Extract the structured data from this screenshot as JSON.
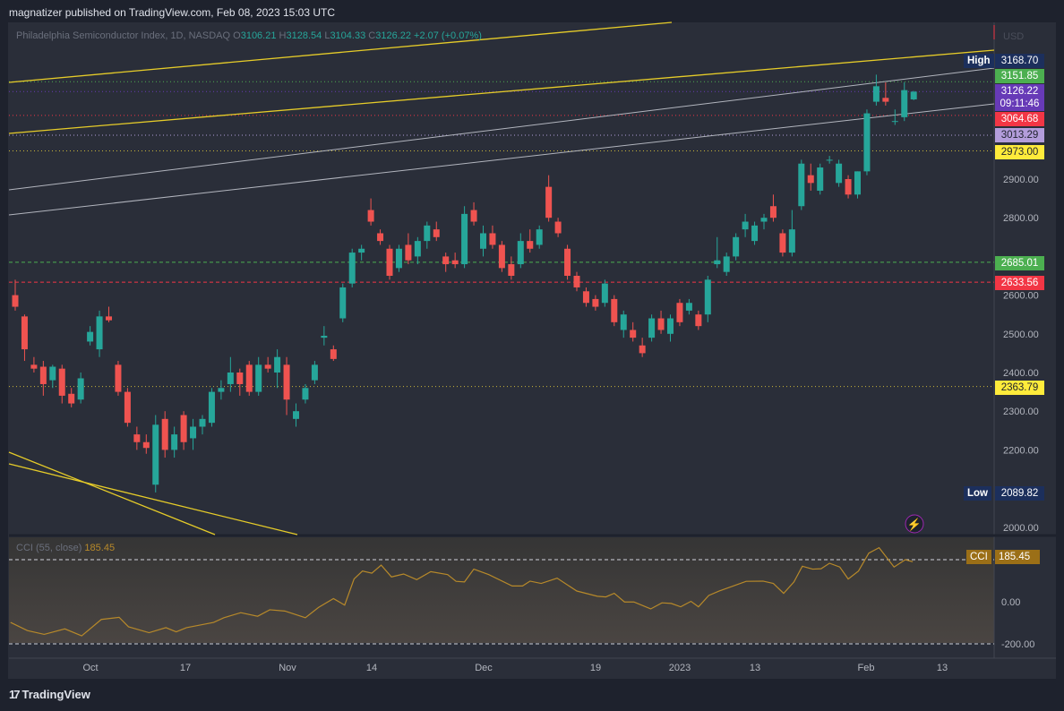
{
  "header": {
    "published": "magnatizer published on TradingView.com, Feb 08, 2023 15:03 UTC"
  },
  "legend": {
    "symbol": "Philadelphia Semiconductor Index, 1D, NASDAQ",
    "o_label": "O",
    "o": "3106.21",
    "h_label": "H",
    "h": "3128.54",
    "l_label": "L",
    "l": "3104.33",
    "c_label": "C",
    "c": "3126.22",
    "change": "+2.07 (+0.07%)"
  },
  "currency": "USD",
  "price_axis": {
    "ticks": [
      2000,
      2200,
      2300,
      2400,
      2500,
      2600,
      2800,
      2900
    ]
  },
  "price_labels": [
    {
      "tag": "High",
      "value": "3168.70",
      "bg": "#1c2f5c",
      "fg": "#ffffff"
    },
    {
      "value": "3151.85",
      "bg": "#4caf50",
      "fg": "#ffffff"
    },
    {
      "value": "3126.22",
      "sub": "09:11:46",
      "bg": "#673ab7",
      "fg": "#ffffff"
    },
    {
      "value": "3064.68",
      "bg": "#f23645",
      "fg": "#ffffff"
    },
    {
      "value": "3013.29",
      "bg": "#b39ddb",
      "fg": "#1e222d"
    },
    {
      "value": "2973.00",
      "bg": "#ffeb3b",
      "fg": "#1e222d"
    },
    {
      "value": "2685.01",
      "bg": "#4caf50",
      "fg": "#ffffff"
    },
    {
      "value": "2633.56",
      "bg": "#f23645",
      "fg": "#ffffff"
    },
    {
      "value": "2363.79",
      "bg": "#ffeb3b",
      "fg": "#1e222d"
    },
    {
      "tag": "Low",
      "value": "2089.82",
      "bg": "#1c2f5c",
      "fg": "#ffffff"
    }
  ],
  "time_axis": [
    "Oct",
    "17",
    "Nov",
    "14",
    "Dec",
    "19",
    "2023",
    "13",
    "Feb",
    "13"
  ],
  "colors": {
    "up": "#26a69a",
    "down": "#ef5350",
    "cci": "#b7892a"
  },
  "chart_data": {
    "type": "candlestick",
    "title": "Philadelphia Semiconductor Index, 1D, NASDAQ",
    "ylim": [
      1980,
      3320
    ],
    "ohlc": [
      [
        2600,
        2640,
        2560,
        2570
      ],
      [
        2545,
        2550,
        2430,
        2460
      ],
      [
        2420,
        2440,
        2400,
        2410
      ],
      [
        2415,
        2430,
        2340,
        2370
      ],
      [
        2380,
        2420,
        2360,
        2415
      ],
      [
        2410,
        2420,
        2320,
        2340
      ],
      [
        2345,
        2360,
        2310,
        2320
      ],
      [
        2330,
        2400,
        2320,
        2385
      ],
      [
        2480,
        2520,
        2470,
        2505
      ],
      [
        2460,
        2560,
        2440,
        2545
      ],
      [
        2545,
        2570,
        2530,
        2535
      ],
      [
        2420,
        2430,
        2340,
        2350
      ],
      [
        2350,
        2360,
        2260,
        2270
      ],
      [
        2240,
        2260,
        2200,
        2220
      ],
      [
        2220,
        2240,
        2190,
        2205
      ],
      [
        2110,
        2290,
        2090,
        2265
      ],
      [
        2280,
        2300,
        2180,
        2200
      ],
      [
        2200,
        2260,
        2180,
        2240
      ],
      [
        2290,
        2300,
        2200,
        2220
      ],
      [
        2230,
        2280,
        2200,
        2260
      ],
      [
        2260,
        2290,
        2240,
        2280
      ],
      [
        2270,
        2360,
        2260,
        2350
      ],
      [
        2350,
        2380,
        2330,
        2360
      ],
      [
        2370,
        2440,
        2350,
        2400
      ],
      [
        2400,
        2410,
        2340,
        2370
      ],
      [
        2420,
        2430,
        2340,
        2350
      ],
      [
        2350,
        2440,
        2340,
        2420
      ],
      [
        2420,
        2440,
        2400,
        2410
      ],
      [
        2400,
        2460,
        2360,
        2440
      ],
      [
        2420,
        2440,
        2290,
        2330
      ],
      [
        2280,
        2320,
        2260,
        2300
      ],
      [
        2330,
        2370,
        2320,
        2360
      ],
      [
        2380,
        2430,
        2370,
        2420
      ],
      [
        2490,
        2520,
        2470,
        2495
      ],
      [
        2460,
        2470,
        2430,
        2435
      ],
      [
        2540,
        2630,
        2530,
        2620
      ],
      [
        2630,
        2720,
        2620,
        2710
      ],
      [
        2710,
        2730,
        2690,
        2720
      ],
      [
        2820,
        2850,
        2780,
        2790
      ],
      [
        2760,
        2770,
        2730,
        2740
      ],
      [
        2720,
        2730,
        2640,
        2650
      ],
      [
        2670,
        2730,
        2660,
        2720
      ],
      [
        2730,
        2760,
        2680,
        2690
      ],
      [
        2700,
        2750,
        2680,
        2740
      ],
      [
        2740,
        2790,
        2720,
        2780
      ],
      [
        2770,
        2790,
        2740,
        2750
      ],
      [
        2700,
        2710,
        2660,
        2680
      ],
      [
        2690,
        2710,
        2670,
        2680
      ],
      [
        2680,
        2830,
        2670,
        2810
      ],
      [
        2820,
        2840,
        2780,
        2790
      ],
      [
        2720,
        2780,
        2700,
        2760
      ],
      [
        2760,
        2780,
        2720,
        2730
      ],
      [
        2730,
        2740,
        2660,
        2670
      ],
      [
        2680,
        2700,
        2640,
        2650
      ],
      [
        2680,
        2760,
        2670,
        2740
      ],
      [
        2740,
        2770,
        2710,
        2720
      ],
      [
        2730,
        2780,
        2720,
        2770
      ],
      [
        2880,
        2910,
        2790,
        2800
      ],
      [
        2790,
        2800,
        2750,
        2760
      ],
      [
        2720,
        2730,
        2640,
        2650
      ],
      [
        2650,
        2660,
        2610,
        2620
      ],
      [
        2610,
        2620,
        2570,
        2580
      ],
      [
        2590,
        2600,
        2560,
        2570
      ],
      [
        2580,
        2640,
        2570,
        2630
      ],
      [
        2590,
        2600,
        2520,
        2530
      ],
      [
        2510,
        2560,
        2490,
        2550
      ],
      [
        2510,
        2530,
        2480,
        2490
      ],
      [
        2470,
        2490,
        2440,
        2450
      ],
      [
        2490,
        2550,
        2480,
        2540
      ],
      [
        2540,
        2560,
        2500,
        2510
      ],
      [
        2500,
        2550,
        2480,
        2540
      ],
      [
        2580,
        2590,
        2520,
        2530
      ],
      [
        2560,
        2590,
        2550,
        2580
      ],
      [
        2550,
        2560,
        2510,
        2520
      ],
      [
        2550,
        2650,
        2530,
        2640
      ],
      [
        2680,
        2750,
        2670,
        2690
      ],
      [
        2660,
        2710,
        2650,
        2700
      ],
      [
        2700,
        2760,
        2690,
        2750
      ],
      [
        2770,
        2810,
        2750,
        2790
      ],
      [
        2740,
        2790,
        2730,
        2780
      ],
      [
        2790,
        2810,
        2770,
        2800
      ],
      [
        2830,
        2860,
        2790,
        2800
      ],
      [
        2760,
        2770,
        2700,
        2710
      ],
      [
        2710,
        2820,
        2700,
        2770
      ],
      [
        2830,
        2950,
        2820,
        2940
      ],
      [
        2910,
        2940,
        2870,
        2890
      ],
      [
        2870,
        2940,
        2860,
        2930
      ],
      [
        2950,
        2960,
        2940,
        2950
      ],
      [
        2890,
        2950,
        2880,
        2940
      ],
      [
        2900,
        2910,
        2850,
        2860
      ],
      [
        2860,
        2920,
        2850,
        2920
      ],
      [
        2920,
        3080,
        2910,
        3070
      ],
      [
        3100,
        3170,
        3090,
        3140
      ],
      [
        3110,
        3150,
        3090,
        3100
      ],
      [
        3050,
        3080,
        3040,
        3050
      ],
      [
        3060,
        3150,
        3050,
        3130
      ],
      [
        3106,
        3128,
        3104,
        3126
      ]
    ],
    "indicator": {
      "name": "CCI (55, close)",
      "value": "185.45",
      "tag": "CCI",
      "ylim": [
        -300,
        290
      ],
      "bands": [
        200,
        -200
      ],
      "ticks": [
        "0.00",
        "-200.00"
      ],
      "points": [
        [
          -0.5,
          -98
        ],
        [
          1.3,
          -137
        ],
        [
          3.1,
          -155
        ],
        [
          5.3,
          -129
        ],
        [
          7.1,
          -162
        ],
        [
          9.2,
          -84
        ],
        [
          11.1,
          -74
        ],
        [
          12.1,
          -119
        ],
        [
          14.3,
          -147
        ],
        [
          16.1,
          -123
        ],
        [
          17.2,
          -143
        ],
        [
          18.3,
          -123
        ],
        [
          21.2,
          -98
        ],
        [
          22.3,
          -76
        ],
        [
          24.1,
          -52
        ],
        [
          25.9,
          -69
        ],
        [
          27.2,
          -38
        ],
        [
          28.8,
          -44
        ],
        [
          31,
          -76
        ],
        [
          32.4,
          -27
        ],
        [
          34,
          15
        ],
        [
          35.2,
          -16
        ],
        [
          36.2,
          108
        ],
        [
          37.1,
          146
        ],
        [
          38.1,
          136
        ],
        [
          39.1,
          174
        ],
        [
          40.2,
          118
        ],
        [
          41.5,
          132
        ],
        [
          42.9,
          105
        ],
        [
          44.4,
          143
        ],
        [
          46.2,
          129
        ],
        [
          47.1,
          97
        ],
        [
          48,
          94
        ],
        [
          49,
          155
        ],
        [
          50.6,
          129
        ],
        [
          53.1,
          75
        ],
        [
          54.2,
          75
        ],
        [
          55,
          98
        ],
        [
          56.2,
          87
        ],
        [
          57.9,
          112
        ],
        [
          60,
          51
        ],
        [
          62.2,
          26
        ],
        [
          63.1,
          23
        ],
        [
          64,
          40
        ],
        [
          65.1,
          -1
        ],
        [
          66.1,
          -1
        ],
        [
          67.9,
          -34
        ],
        [
          69.1,
          -5
        ],
        [
          70.1,
          -8
        ],
        [
          71.1,
          -24
        ],
        [
          72.2,
          2
        ],
        [
          73,
          -24
        ],
        [
          74.1,
          30
        ],
        [
          75.2,
          51
        ],
        [
          78.1,
          97
        ],
        [
          79.9,
          98
        ],
        [
          81,
          87
        ],
        [
          82.1,
          40
        ],
        [
          83.2,
          94
        ],
        [
          84.1,
          169
        ],
        [
          85.2,
          155
        ],
        [
          86.1,
          157
        ],
        [
          87,
          183
        ],
        [
          88.1,
          165
        ],
        [
          89,
          108
        ],
        [
          90.1,
          146
        ],
        [
          91.2,
          231
        ],
        [
          92.3,
          257
        ],
        [
          93.9,
          165
        ],
        [
          95.1,
          200
        ],
        [
          95.9,
          190
        ]
      ]
    }
  },
  "footer": {
    "brand": "TradingView"
  }
}
